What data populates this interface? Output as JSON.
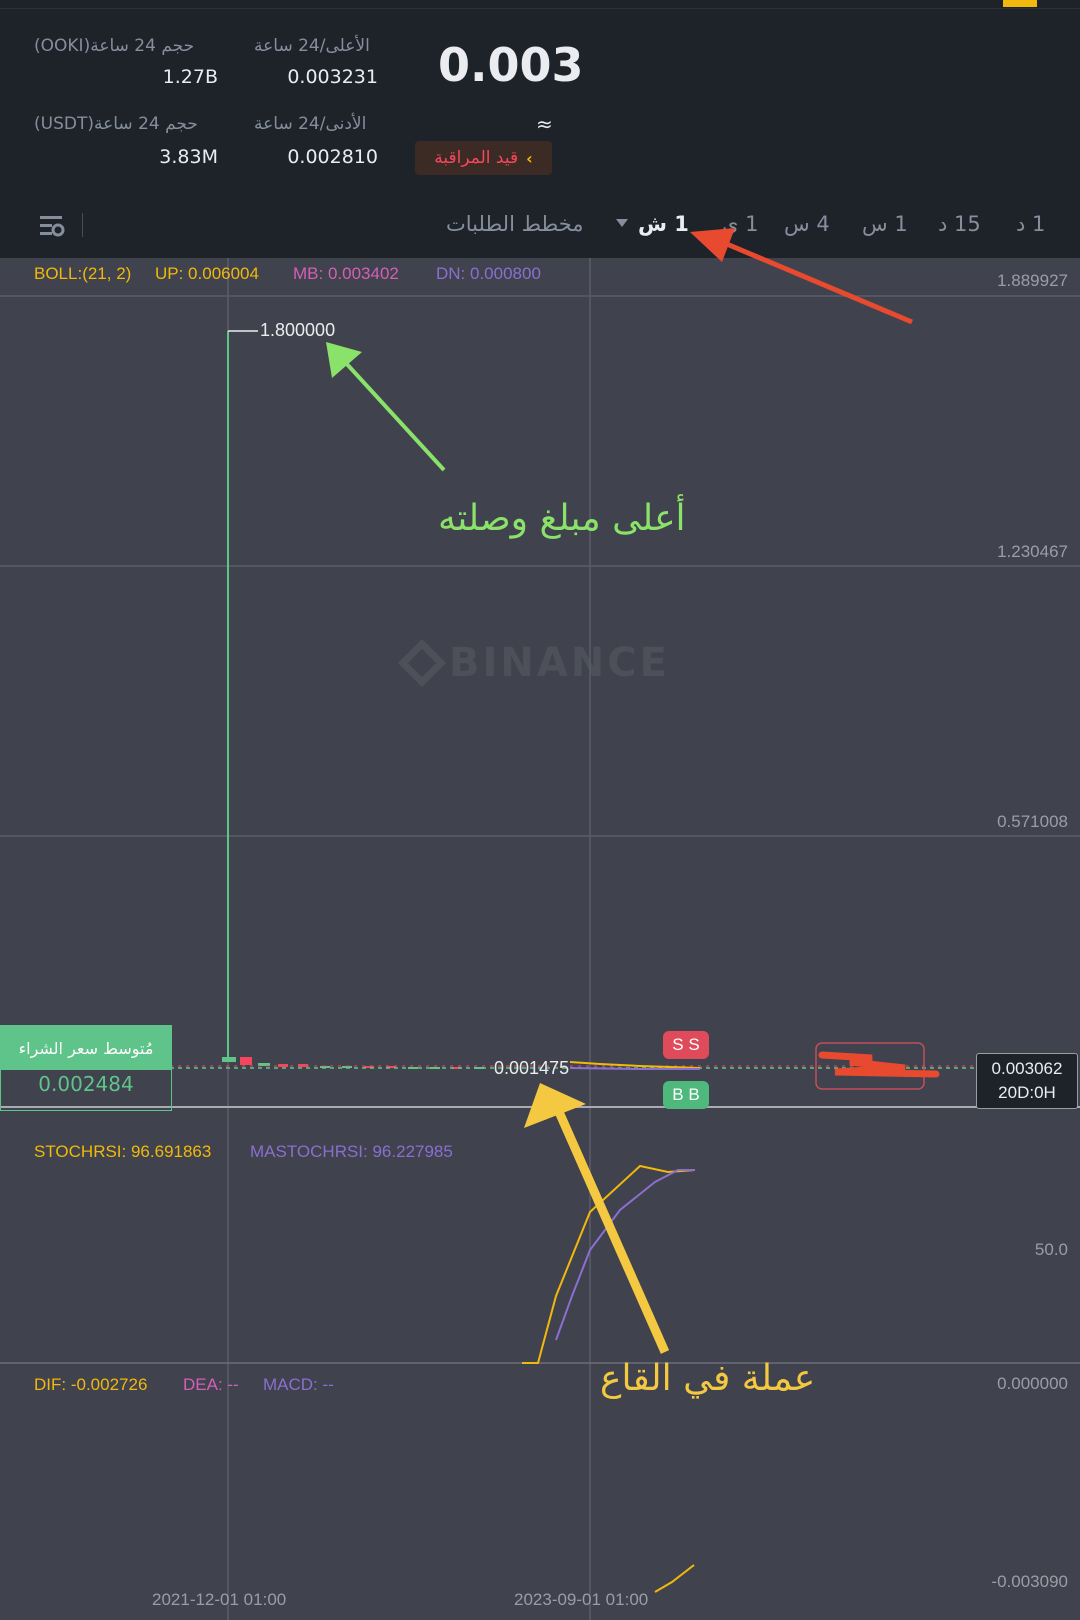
{
  "ticker": {
    "price": "0.003",
    "approx": "≈",
    "watch_label": "قيد المراقبة",
    "watch_chevron": "‹",
    "high_label": "الأعلى/24 ساعة",
    "high_value": "0.003231",
    "low_label": "الأدنى/24 ساعة",
    "low_value": "0.002810",
    "vol_base_label": "حجم 24 ساعة(OOKI)",
    "vol_base_value": "1.27B",
    "vol_quote_label": "حجم 24 ساعة(USDT)",
    "vol_quote_value": "3.83M"
  },
  "tabs": {
    "t1m": "1 د",
    "t15m": "15 د",
    "t1h": "1 س",
    "t4h": "4 س",
    "t1d": "1 ي",
    "t1M": "1 ش",
    "depth": "مخطط الطلبات",
    "active": "1 ش"
  },
  "indicators": {
    "boll": "BOLL:(21, 2)",
    "up": "UP: 0.006004",
    "mb": "MB: 0.003402",
    "dn": "DN: 0.000800",
    "stoch": "STOCHRSI: 96.691863",
    "mastoch": "MASTOCHRSI: 96.227985",
    "dif": "DIF: -0.002726",
    "dea": "DEA: --",
    "macd": "MACD: --"
  },
  "axis": {
    "y1": "1.889927",
    "y2": "1.230467",
    "y3": "0.571008",
    "stoch_mid": "50.0",
    "macd_top": "0.000000",
    "macd_bottom": "-0.003090",
    "x1": "2021-12-01 01:00",
    "x2": "2023-09-01 01:00"
  },
  "chart_labels": {
    "watermark": "BINANCE",
    "high_marker": "1.800000",
    "low_marker": "0.001475",
    "avg_title": "مُتوسط سعر الشراء",
    "avg_value": "0.002484",
    "cur_price": "0.003062",
    "countdown": "20D:0H",
    "sell_badge": "S S",
    "buy_badge": "B B"
  },
  "annotations": {
    "green": "أعلى مبلغ وصلته",
    "yellow": "عملة في القاع"
  },
  "colors": {
    "up": "#5ec48a",
    "down": "#f6465d",
    "accent": "#f0b90b",
    "green_arrow": "#8ae26a",
    "red_arrow": "#e84a30",
    "yellow_arrow": "#f5c842"
  }
}
